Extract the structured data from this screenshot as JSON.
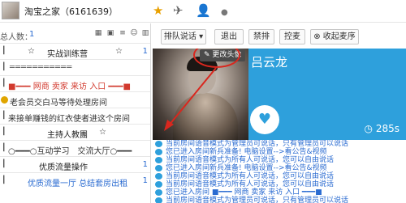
{
  "window": {
    "title": "淘宝之家（6161639）"
  },
  "left_panel": {
    "total_label": "总人数：",
    "total_value": "1",
    "rooms": [
      {
        "name": "实战训练营",
        "count": "1",
        "prefix": "☆",
        "suffix": "☆"
      },
      {
        "name": "═══════════",
        "count": "",
        "prefix": "",
        "suffix": ""
      },
      {
        "name": "■━━━ 网商 卖家 来访 入口 ━━━■",
        "count": "",
        "prefix": "",
        "suffix": ""
      },
      {
        "name": "老会员交白马等待处理房间",
        "count": "",
        "prefix": "",
        "suffix": ""
      },
      {
        "name": "来接单赚钱的红衣使者进这个房间",
        "count": "",
        "prefix": "",
        "suffix": ""
      },
      {
        "name": "主持人教團",
        "count": "",
        "prefix": "",
        "suffix": "☆"
      },
      {
        "name": "○━━━○互动学习　交流大厅○━━━",
        "count": "",
        "prefix": "",
        "suffix": ""
      },
      {
        "name": "优质流量操作",
        "count": "1",
        "prefix": "",
        "suffix": ""
      },
      {
        "name": "优质流量一厅  总结套房出租",
        "count": "1",
        "prefix": "",
        "suffix": ""
      }
    ]
  },
  "toolbar": {
    "mode_select": "排队说话",
    "exit": "退出",
    "ban": "禁排",
    "control": "控麦",
    "collect": "收起麦序"
  },
  "profile": {
    "edit_avatar": "更改头像",
    "nickname": "吕云龙",
    "timer": "285s"
  },
  "chat": {
    "messages": [
      "当前房间语音模式为管理员可说话，只有管理员可以说话",
      "您已进入房间新兵准备! 电脑设置-->看公告&视频",
      "当前房间语音模式为所有人可说话，您可以自由说话",
      "您已进入房间新兵准备! 电脑设置-->看公告&视频",
      "当前房间语音模式为所有人可说话，您可以自由说话",
      "当前房间语音模式为所有人可说话，您可以自由说话",
      "您已进入房间 ■━━━ 网商 卖家 来访 入口 ━━━■",
      "当前房间语音模式为管理员可说话，只有管理员可以说话"
    ]
  },
  "colors": {
    "accent": "#2ea0dc",
    "link": "#2a6bd1",
    "star": "#e8a000",
    "highlight_ring": "#d9271e"
  },
  "icons": [
    "star-icon",
    "plane-icon",
    "user-add-icon",
    "heart-icon",
    "clock-icon",
    "pencil-icon"
  ]
}
